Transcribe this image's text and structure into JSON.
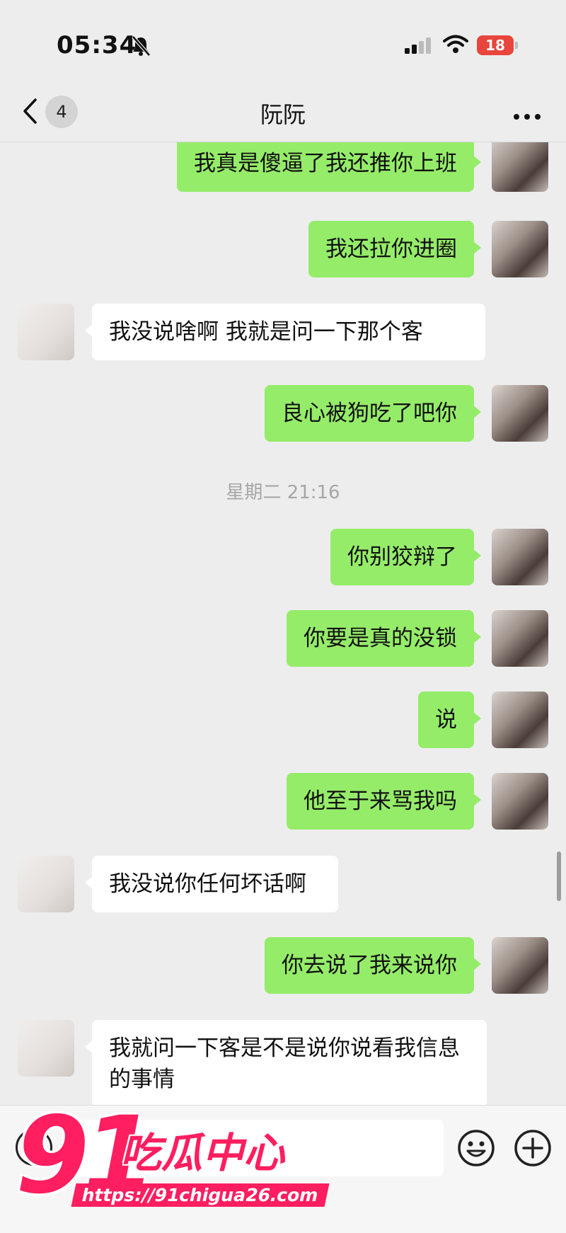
{
  "status_bar": {
    "time": "05:34",
    "battery": "18"
  },
  "header": {
    "back_label": "‹",
    "unread_count": "4",
    "title": "阮阮",
    "more_label": "···"
  },
  "messages": [
    {
      "side": "sent",
      "text": "我真是傻逼了我还推你上班"
    },
    {
      "side": "sent",
      "text": "我还拉你进圈"
    },
    {
      "side": "received",
      "text": "我没说啥啊 我就是问一下那个客"
    },
    {
      "side": "sent",
      "text": "良心被狗吃了吧你"
    },
    {
      "side": "time",
      "text": "星期二 21:16"
    },
    {
      "side": "sent",
      "text": "你别狡辩了"
    },
    {
      "side": "sent",
      "text": "你要是真的没锁"
    },
    {
      "side": "sent",
      "text": "说"
    },
    {
      "side": "sent",
      "text": "他至于来骂我吗"
    },
    {
      "side": "received",
      "text": "我没说你任何坏话啊"
    },
    {
      "side": "sent",
      "text": "你去说了我来说你"
    },
    {
      "side": "received",
      "text": "我就问一下客是不是说你说看我信息的事情"
    }
  ],
  "watermark": {
    "number": "91",
    "name": "吃瓜中心",
    "url": "https://91chigua26.com"
  },
  "colors": {
    "sent_bubble": "#95ec69",
    "received_bubble": "#ffffff",
    "background": "#ededed",
    "watermark": "#ff1e5f"
  }
}
